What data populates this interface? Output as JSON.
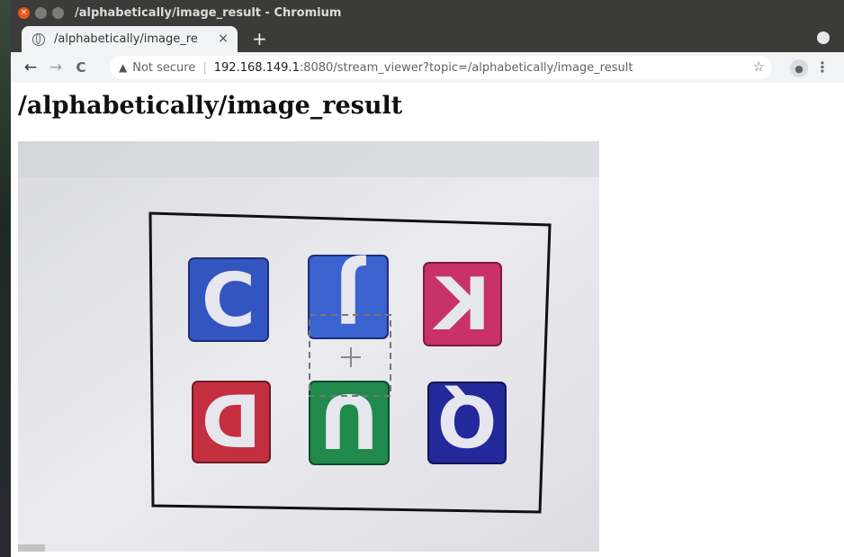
{
  "window": {
    "title": "/alphabetically/image_result - Chromium"
  },
  "tab": {
    "title": "/alphabetically/image_re",
    "close": "×",
    "new": "+"
  },
  "toolbar": {
    "back": "←",
    "forward": "→",
    "reload": "C",
    "security": "Not secure",
    "url_host": "192.168.149.1",
    "url_path": ":8080/stream_viewer?topic=/alphabetically/image_result"
  },
  "page": {
    "heading": "/alphabetically/image_result"
  },
  "stream": {
    "letters": [
      "C",
      "J",
      "K",
      "D",
      "U",
      "Q"
    ],
    "colors": {
      "blue": "#3355c0",
      "red": "#c42f3f",
      "pink": "#c8316a",
      "green": "#1f8a4c",
      "navy": "#23299a"
    }
  }
}
